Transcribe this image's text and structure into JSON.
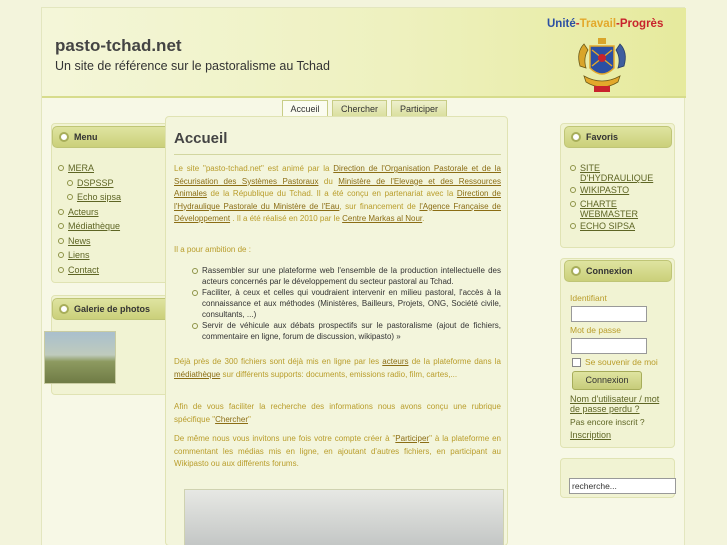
{
  "header": {
    "site_name": "pasto-tchad.net",
    "slogan": "Un site de référence sur le pastoralisme au Tchad",
    "motto_1": "Unité",
    "motto_sep_1": "-",
    "motto_2": "Travail",
    "motto_sep_2": "-",
    "motto_3": "Progrès",
    "emblem_icon": "tchad-coat-of-arms-icon"
  },
  "nav": {
    "tabs": [
      "Accueil",
      "Chercher",
      "Participer"
    ]
  },
  "menu": {
    "title": "Menu",
    "items": [
      "MERA",
      "DSPSSP",
      "Echo sipsa",
      "Acteurs",
      "Médiathèque",
      "News",
      "Liens",
      "Contact"
    ]
  },
  "gallery": {
    "title": "Galerie de photos"
  },
  "main": {
    "title": "Accueil",
    "p1": {
      "t1": "Le site \"pasto-tchad.net\" est animé par la ",
      "l1": "Direction de l'Organisation Pastorale et de la Sécurisation des Systèmes Pastoraux",
      "t2": "  du ",
      "l2": "Ministère de l'Elevage et des Ressources Animales",
      "t3": " de la République du Tchad. Il a été conçu en partenariat avec la ",
      "l3": "Direction de l'Hydraulique Pastorale du Ministère de l'Eau",
      "t4": ", sur financement de ",
      "l4": "l'Agence Française de Développement",
      "t5": " . Il a été réalisé en 2010 par le ",
      "l5": "Centre Markas al Nour",
      "t6": "."
    },
    "p2": "Il a pour ambition de :",
    "ambitions": [
      "Rassembler sur une plateforme web l'ensemble de la production intellectuelle des acteurs concernés par le développement du secteur pastoral au Tchad.",
      "Faciliter, à ceux et celles qui voudraient intervenir en milieu pastoral, l'accès à la connaissance et aux méthodes (Ministères, Bailleurs, Projets, ONG, Société civile, consultants, ...)",
      "Servir de véhicule aux débats prospectifs sur le pastoralisme (ajout de fichiers, commentaire en ligne, forum de discussion, wikipasto) »"
    ],
    "p3": {
      "t1": "Déjà près de 300 fichiers sont déjà mis en ligne par les ",
      "l1": "acteurs",
      "t2": " de la plateforme dans la ",
      "l2": "médiathèque",
      "t3": " sur différents supports: documents, emissions radio, film, cartes,..."
    },
    "p4": {
      "t1": "Afin de vous faciliter la recherche des informations nous avons conçu une rubrique spécifique \"",
      "l1": "Chercher",
      "t2": "\""
    },
    "p5": {
      "t1": "De même nous vous invitons une fois votre compte créer à \"",
      "l1": "Participer",
      "t2": "\" à la plateforme en commentant les médias mis en ligne, en ajoutant d'autres fichiers, en participant au Wikipasto ou aux différents forums."
    }
  },
  "favoris": {
    "title": "Favoris",
    "items": [
      "SITE D'HYDRAULIQUE",
      "WIKIPASTO",
      "CHARTE WEBMASTER",
      "ECHO SIPSA"
    ]
  },
  "login": {
    "title": "Connexion",
    "username_label": "Identifiant",
    "username_value": "",
    "password_label": "Mot de passe",
    "password_value": "",
    "remember_label": "Se souvenir de moi",
    "submit_label": "Connexion",
    "forgot_label": "Nom d'utilisateur / mot de passe perdu ?",
    "not_registered": "Pas encore inscrit ?",
    "register_label": "Inscription"
  },
  "search": {
    "value": "recherche..."
  }
}
